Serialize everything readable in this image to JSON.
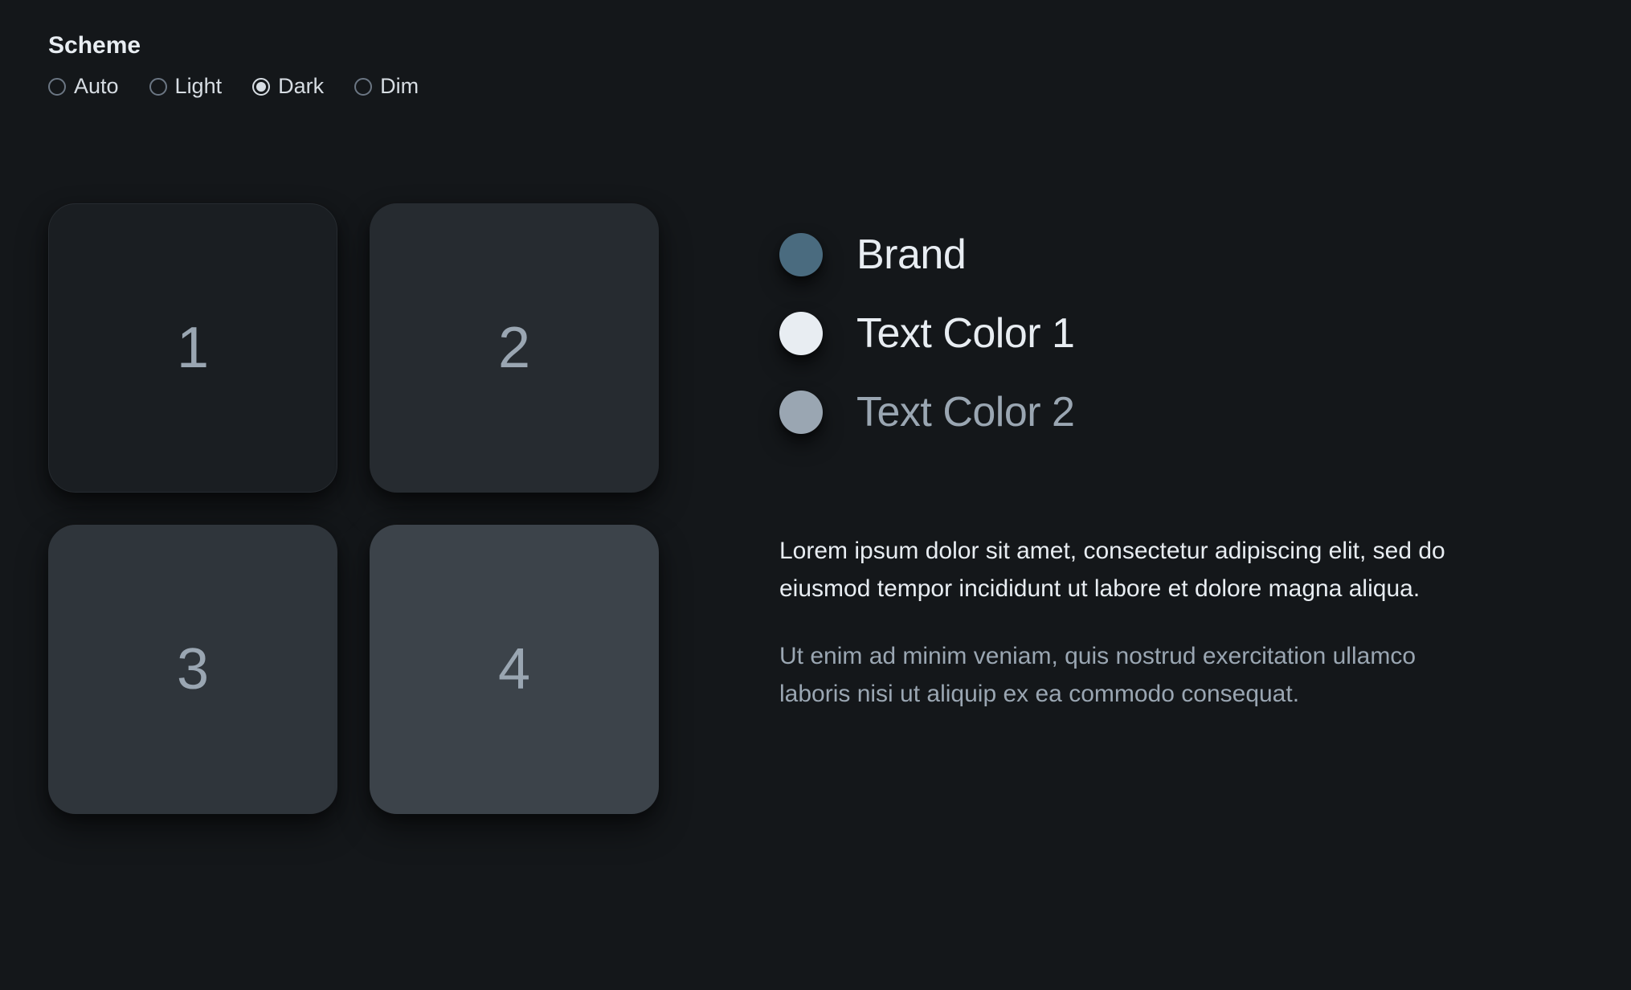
{
  "scheme": {
    "title": "Scheme",
    "options": [
      {
        "id": "auto",
        "label": "Auto",
        "checked": false
      },
      {
        "id": "light",
        "label": "Light",
        "checked": false
      },
      {
        "id": "dark",
        "label": "Dark",
        "checked": true
      },
      {
        "id": "dim",
        "label": "Dim",
        "checked": false
      }
    ]
  },
  "swatches": [
    {
      "label": "1",
      "class": "swatch-1"
    },
    {
      "label": "2",
      "class": "swatch-2"
    },
    {
      "label": "3",
      "class": "swatch-3"
    },
    {
      "label": "4",
      "class": "swatch-4"
    }
  ],
  "legend": [
    {
      "label": "Brand",
      "color": "#4a6b7f",
      "text_color": "#e8edf2"
    },
    {
      "label": "Text Color 1",
      "color": "#e8edf2",
      "text_color": "#e8edf2"
    },
    {
      "label": "Text Color 2",
      "color": "#9aa6b2",
      "text_color": "#9aa6b2"
    }
  ],
  "body": {
    "para1": "Lorem ipsum dolor sit amet, consectetur adipiscing elit, sed do eiusmod tempor incididunt ut labore et dolore magna aliqua.",
    "para2": "Ut enim ad minim veniam, quis nostrud exercitation ullamco laboris nisi ut aliquip ex ea commodo consequat."
  }
}
